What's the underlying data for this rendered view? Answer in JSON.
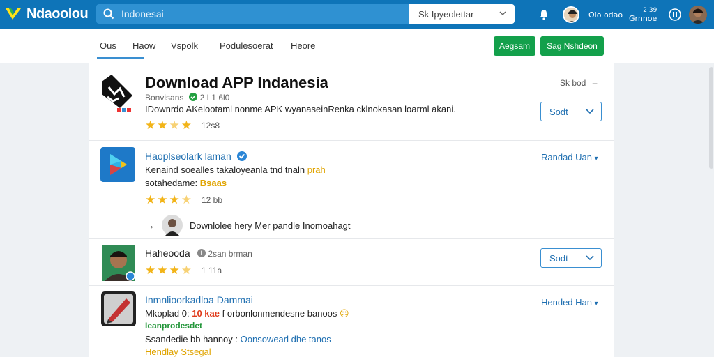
{
  "header": {
    "logo_text": "Ndaoolou",
    "search_placeholder": "Indonesai",
    "select_value": "Sk Ipyeolettar",
    "account_1": "Olo odao",
    "account_2": "Grnnoe ",
    "account_2_badge": "2 39"
  },
  "subnav": {
    "tabs": [
      "Ous",
      "Haow",
      "Vspolk",
      "Podulesoerat",
      "Heore"
    ],
    "btn_primary": "Aegsam",
    "btn_secondary": "Sag Nshdeon"
  },
  "rows": [
    {
      "title": "Download APP Indanesia",
      "meta_prefix": "Bonvisans",
      "meta_rating": "2 L1 6l0",
      "desc": "IDownrdo AKelootaml nonme APK wyanaseinRenka cklnokasan loarml akani.",
      "rating_count": "12s8",
      "right_label": "Sk bod",
      "button": "Sodt"
    },
    {
      "title": "Haoplseolark laman",
      "desc": "Kenaind soealles takaloyeanla tnd tnaln",
      "desc_highlight": "prah",
      "sub_label": "sotahedame:",
      "sub_value": "Bsaas",
      "rating_count": "12 bb",
      "right_label": "Randad Uan",
      "reply_text": "Downlolee hery Mer pandle Inomoahagt"
    },
    {
      "title": "Haheooda",
      "meta": "2san brman",
      "rating_count": "1 11a",
      "button": "Sodt"
    },
    {
      "title": "Inmnlioorkadloa Dammai",
      "line1_prefix": "Mkoplad 0:",
      "line1_red": "10 kae",
      "line1_rest": "f orbonlonmendesne banoos",
      "line2_green": "Ieanprodesdet",
      "line3_prefix": "Ssandedie bb hannoy :",
      "line3_blue": "Oonsowearl dhe tanos",
      "line4_orange": "Hendlay Stsegal",
      "right_label": "Hended Han"
    }
  ]
}
